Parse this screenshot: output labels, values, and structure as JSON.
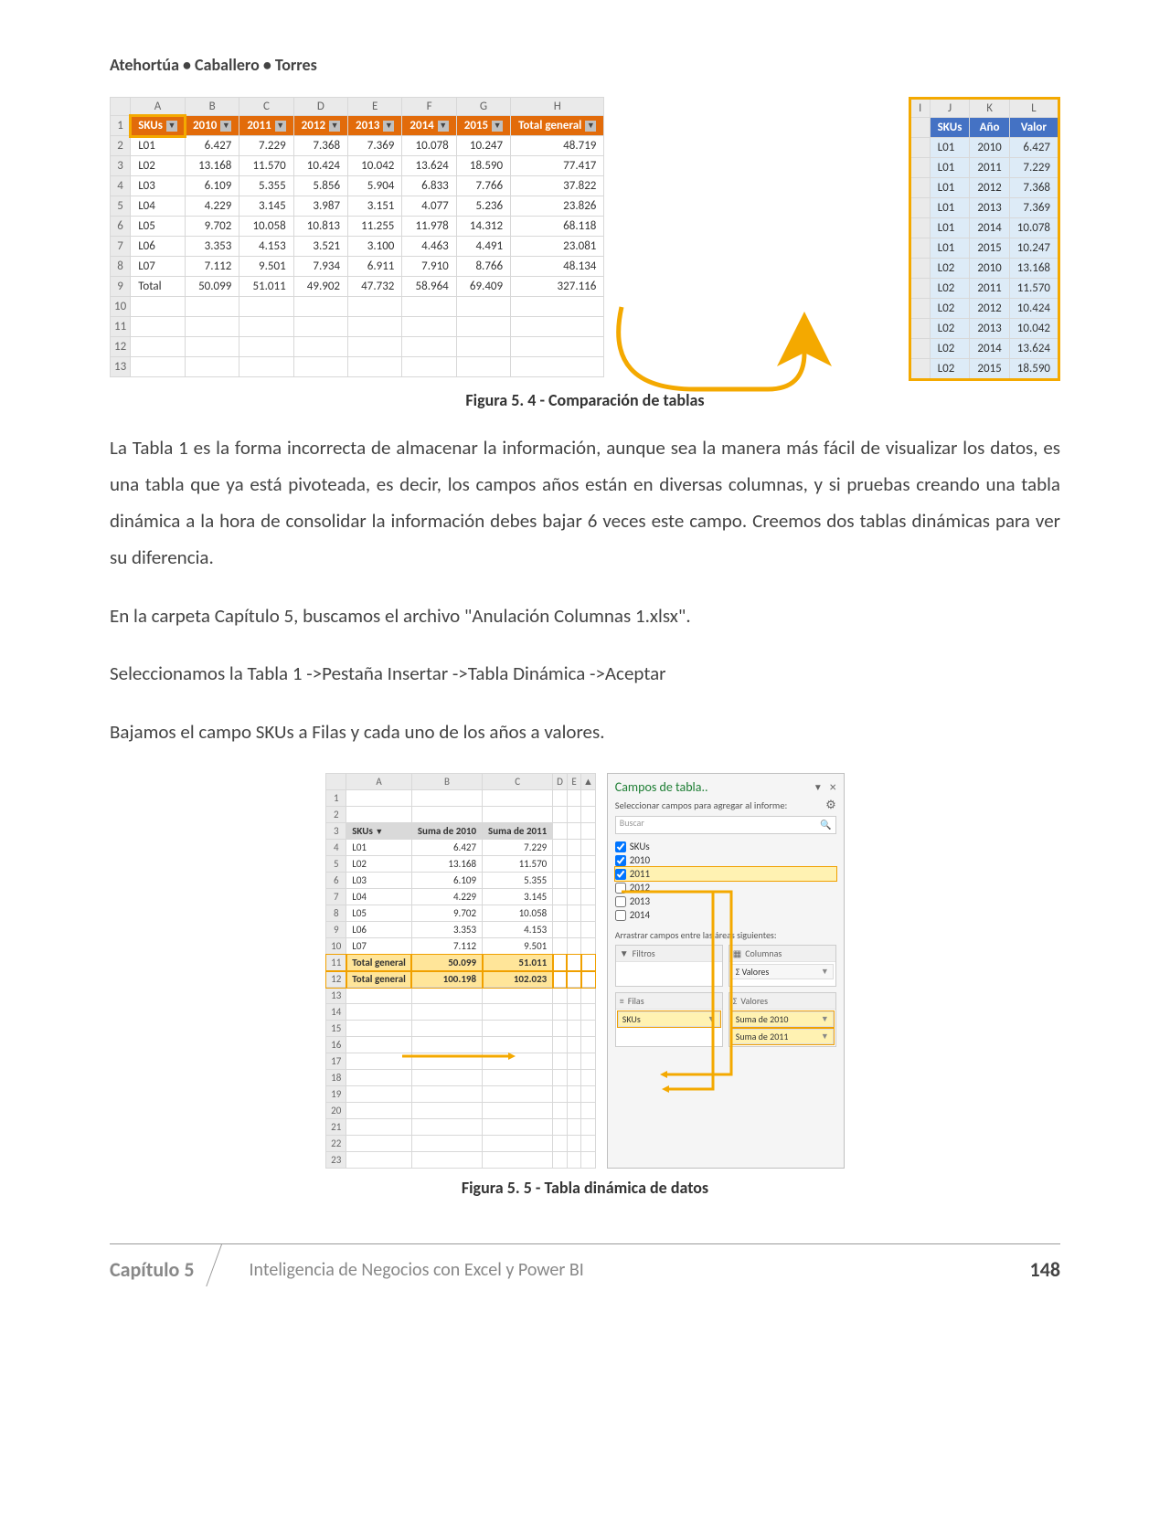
{
  "authors": "Atehortúa • Caballero • Torres",
  "fig54": {
    "cols": [
      "A",
      "B",
      "C",
      "D",
      "E",
      "F",
      "G",
      "H",
      "I",
      "J",
      "K",
      "L"
    ],
    "row_nums": [
      "1",
      "2",
      "3",
      "4",
      "5",
      "6",
      "7",
      "8",
      "9",
      "10",
      "11",
      "12",
      "13"
    ],
    "pivot_headers": [
      "SKUs",
      "2010",
      "2011",
      "2012",
      "2013",
      "2014",
      "2015",
      "Total general"
    ],
    "pivot_rows": [
      [
        "L01",
        "6.427",
        "7.229",
        "7.368",
        "7.369",
        "10.078",
        "10.247",
        "48.719"
      ],
      [
        "L02",
        "13.168",
        "11.570",
        "10.424",
        "10.042",
        "13.624",
        "18.590",
        "77.417"
      ],
      [
        "L03",
        "6.109",
        "5.355",
        "5.856",
        "5.904",
        "6.833",
        "7.766",
        "37.822"
      ],
      [
        "L04",
        "4.229",
        "3.145",
        "3.987",
        "3.151",
        "4.077",
        "5.236",
        "23.826"
      ],
      [
        "L05",
        "9.702",
        "10.058",
        "10.813",
        "11.255",
        "11.978",
        "14.312",
        "68.118"
      ],
      [
        "L06",
        "3.353",
        "4.153",
        "3.521",
        "3.100",
        "4.463",
        "4.491",
        "23.081"
      ],
      [
        "L07",
        "7.112",
        "9.501",
        "7.934",
        "6.911",
        "7.910",
        "8.766",
        "48.134"
      ],
      [
        "Total",
        "50.099",
        "51.011",
        "49.902",
        "47.732",
        "58.964",
        "69.409",
        "327.116"
      ]
    ],
    "tall_headers": [
      "SKUs",
      "Año",
      "Valor"
    ],
    "tall_rows": [
      [
        "L01",
        "2010",
        "6.427"
      ],
      [
        "L01",
        "2011",
        "7.229"
      ],
      [
        "L01",
        "2012",
        "7.368"
      ],
      [
        "L01",
        "2013",
        "7.369"
      ],
      [
        "L01",
        "2014",
        "10.078"
      ],
      [
        "L01",
        "2015",
        "10.247"
      ],
      [
        "L02",
        "2010",
        "13.168"
      ],
      [
        "L02",
        "2011",
        "11.570"
      ],
      [
        "L02",
        "2012",
        "10.424"
      ],
      [
        "L02",
        "2013",
        "10.042"
      ],
      [
        "L02",
        "2014",
        "13.624"
      ],
      [
        "L02",
        "2015",
        "18.590"
      ]
    ],
    "caption": "Figura 5. 4 -  Comparación de tablas"
  },
  "p1": "La Tabla 1 es la forma incorrecta de almacenar la información, aunque sea la manera más fácil de visualizar los datos, es una tabla que ya está pivoteada, es decir, los campos años están en diversas columnas, y si pruebas creando una tabla dinámica a la hora de consolidar la información debes bajar 6 veces este campo. Creemos dos tablas dinámicas para ver su diferencia.",
  "p2": "En la carpeta Capítulo 5, buscamos el archivo \"Anulación Columnas 1.xlsx\".",
  "p3": "Seleccionamos la Tabla 1 ->Pestaña Insertar ->Tabla Dinámica ->Aceptar",
  "p4": "Bajamos el campo SKUs a Filas y cada uno de los años a valores.",
  "fig55": {
    "cols": [
      "A",
      "B",
      "C",
      "D",
      "E"
    ],
    "row_nums": [
      "1",
      "2",
      "3",
      "4",
      "5",
      "6",
      "7",
      "8",
      "9",
      "10",
      "11",
      "12",
      "13",
      "14",
      "15",
      "16",
      "17",
      "18",
      "19",
      "20",
      "21",
      "22",
      "23"
    ],
    "headers": [
      "SKUs",
      "Suma de 2010",
      "Suma de 2011"
    ],
    "rows": [
      [
        "L01",
        "6.427",
        "7.229"
      ],
      [
        "L02",
        "13.168",
        "11.570"
      ],
      [
        "L03",
        "6.109",
        "5.355"
      ],
      [
        "L04",
        "4.229",
        "3.145"
      ],
      [
        "L05",
        "9.702",
        "10.058"
      ],
      [
        "L06",
        "3.353",
        "4.153"
      ],
      [
        "L07",
        "7.112",
        "9.501"
      ]
    ],
    "totals": [
      [
        "Total general",
        "50.099",
        "51.011"
      ],
      [
        "Total general",
        "100.198",
        "102.023"
      ]
    ],
    "pane": {
      "title": "Campos de tabla..",
      "subtitle": "Seleccionar campos para agregar al informe:",
      "search_placeholder": "Buscar",
      "fields": [
        {
          "label": "SKUs",
          "checked": true,
          "hl": false
        },
        {
          "label": "2010",
          "checked": true,
          "hl": false
        },
        {
          "label": "2011",
          "checked": true,
          "hl": true
        },
        {
          "label": "2012",
          "checked": false,
          "hl": false
        },
        {
          "label": "2013",
          "checked": false,
          "hl": false
        },
        {
          "label": "2014",
          "checked": false,
          "hl": false
        }
      ],
      "areas_label": "Arrastrar campos entre las áreas siguientes:",
      "area_filters": "Filtros",
      "area_columns": "Columnas",
      "area_rows": "Filas",
      "area_values": "Valores",
      "columns_items": [
        "Σ Valores"
      ],
      "rows_items": [
        "SKUs"
      ],
      "values_items": [
        "Suma de 2010",
        "Suma de 2011"
      ]
    },
    "caption": "Figura 5. 5 -  Tabla dinámica de datos"
  },
  "footer": {
    "chapter": "Capítulo 5",
    "title": "Inteligencia de Negocios con Excel y Power BI",
    "page": "148"
  }
}
